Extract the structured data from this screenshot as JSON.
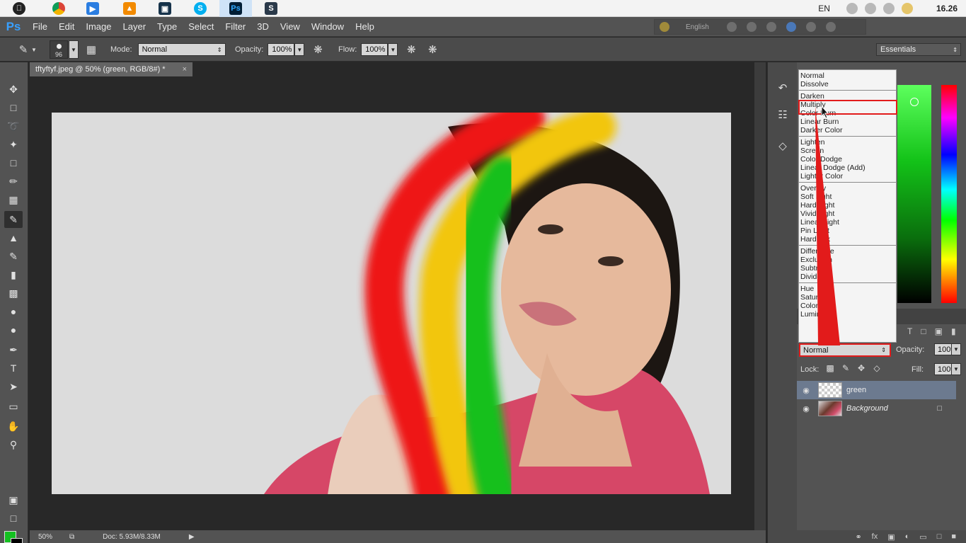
{
  "taskbar": {
    "language": "EN",
    "clock": "16.26"
  },
  "menubar": {
    "logo": "Ps",
    "items": [
      "File",
      "Edit",
      "Image",
      "Layer",
      "Type",
      "Select",
      "Filter",
      "3D",
      "View",
      "Window",
      "Help"
    ],
    "language_box": "English"
  },
  "options": {
    "brush_size": "96",
    "mode_label": "Mode:",
    "mode_value": "Normal",
    "opacity_label": "Opacity:",
    "opacity_value": "100%",
    "flow_label": "Flow:",
    "flow_value": "100%",
    "workspace": "Essentials"
  },
  "document": {
    "tab_title": "tftyftyf.jpeg @ 50% (green, RGB/8#) *",
    "close_glyph": "×"
  },
  "status": {
    "zoom": "50%",
    "doc_info": "Doc: 5.93M/8.33M"
  },
  "blend_dropdown": {
    "groups": [
      [
        "Normal",
        "Dissolve"
      ],
      [
        "Darken",
        "Multiply",
        "Color Burn",
        "Linear Burn",
        "Darker Color"
      ],
      [
        "Lighten",
        "Screen",
        "Color Dodge",
        "Linear Dodge (Add)",
        "Lighter Color"
      ],
      [
        "Overlay",
        "Soft Light",
        "Hard Light",
        "Vivid Light",
        "Linear Light",
        "Pin Light",
        "Hard Mix"
      ],
      [
        "Difference",
        "Exclusion",
        "Subtract",
        "Divide"
      ],
      [
        "Hue",
        "Saturation",
        "Color",
        "Luminosity"
      ]
    ],
    "highlighted": "Multiply"
  },
  "layers": {
    "blend_value": "Normal",
    "opacity_label": "Opacity:",
    "opacity_value": "100%",
    "lock_label": "Lock:",
    "fill_label": "Fill:",
    "fill_value": "100%",
    "rows": [
      {
        "name": "green",
        "selected": true
      },
      {
        "name": "Background",
        "selected": false
      }
    ]
  },
  "colors": {
    "foreground": "#14c021",
    "background": "#000000",
    "accent": "#e21b1b"
  },
  "icons": {
    "toolbox": [
      "move-icon",
      "marquee-icon",
      "lasso-icon",
      "quick-select-icon",
      "crop-icon",
      "eyedropper-icon",
      "healing-icon",
      "brush-icon",
      "stamp-icon",
      "history-brush-icon",
      "eraser-icon",
      "gradient-icon",
      "blur-icon",
      "dodge-icon",
      "pen-icon",
      "type-icon",
      "path-select-icon",
      "shape-icon",
      "hand-icon",
      "zoom-icon"
    ]
  }
}
